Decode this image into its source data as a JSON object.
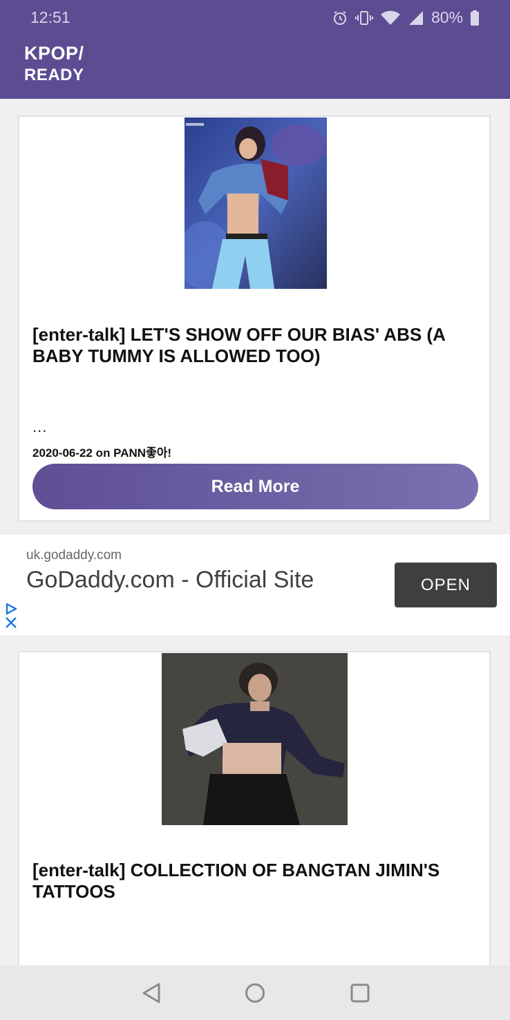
{
  "status": {
    "time": "12:51",
    "battery": "80%"
  },
  "app": {
    "logo_line1": "KPOP/",
    "logo_line2": "READY"
  },
  "posts": [
    {
      "title": "[enter-talk] LET'S SHOW OFF OUR BIAS' ABS (A BABY TUMMY IS ALLOWED TOO)",
      "excerpt": "...",
      "meta": "2020-06-22 on PANN좋아!",
      "button": "Read More"
    },
    {
      "title": "[enter-talk] COLLECTION OF BANGTAN JIMIN'S TATTOOS",
      "excerpt": "..."
    }
  ],
  "ad": {
    "domain": "uk.godaddy.com",
    "headline": "GoDaddy.com - Official Site",
    "cta": "OPEN"
  },
  "colors": {
    "brand": "#5c4d92",
    "button": "#6e62a5",
    "ad_button": "#3f3f3f",
    "ad_accent": "#1a73e8"
  },
  "icons": [
    "alarm-icon",
    "vibrate-icon",
    "wifi-icon",
    "signal-icon",
    "battery-icon",
    "adchoices-icon",
    "close-icon",
    "back-icon",
    "home-icon",
    "recents-icon"
  ]
}
